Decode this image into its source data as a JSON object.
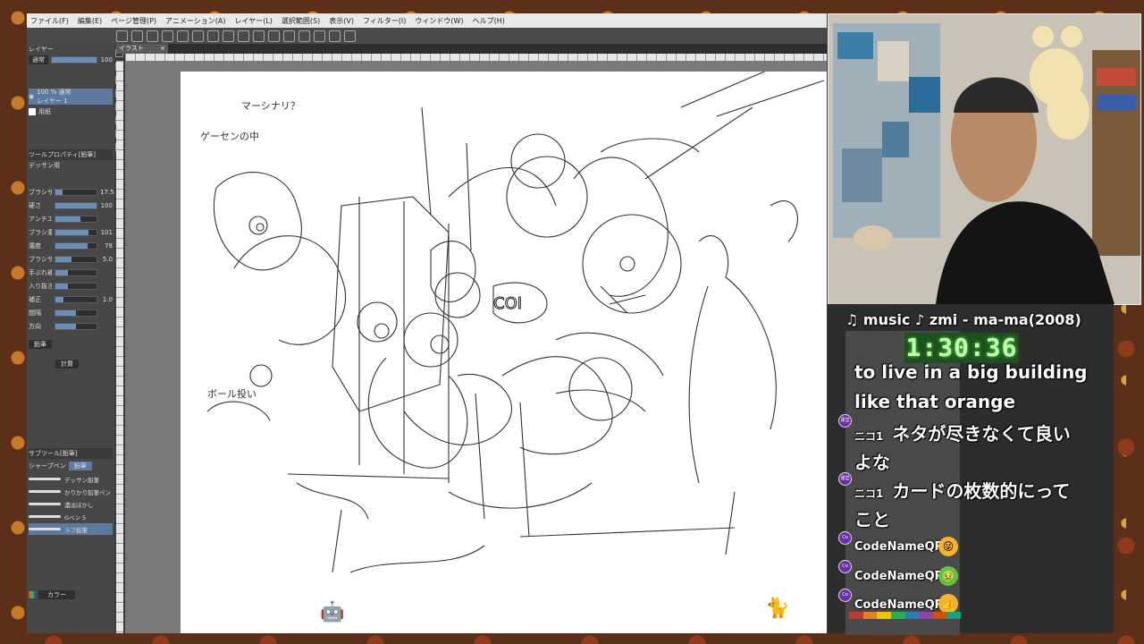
{
  "app": {
    "menu": [
      "ファイル(F)",
      "編集(E)",
      "ページ管理(P)",
      "アニメーション(A)",
      "レイヤー(L)",
      "選択範囲(S)",
      "表示(V)",
      "フィルター(I)",
      "ウィンドウ(W)",
      "ヘルプ(H)"
    ],
    "tab_label": "イラスト",
    "tab_close": "×"
  },
  "layer_panel": {
    "header": "レイヤー",
    "blend_mode": "通常",
    "opacity": "100",
    "layer1_name": "100 % 通常",
    "layer1_sub": "レイヤー 1",
    "paper_name": "用紙"
  },
  "tool_property": {
    "header": "ツールプロパティ[鉛筆]",
    "brush_name": "デッサン用",
    "rows": [
      {
        "label": "ブラシサイズ",
        "value": "17.5",
        "level": 0.18
      },
      {
        "label": "硬さ",
        "value": "100",
        "level": 1.0
      },
      {
        "label": "アンチエイリアス",
        "value": "",
        "level": 0.6
      },
      {
        "label": "ブラシ濃度",
        "value": "101",
        "level": 0.8
      },
      {
        "label": "濃度",
        "value": "78",
        "level": 0.78
      },
      {
        "label": "ブラシサイズ",
        "value": "5.0",
        "level": 0.4
      },
      {
        "label": "手ぶれ補正",
        "value": "",
        "level": 0.3
      },
      {
        "label": "入り抜き",
        "value": "",
        "level": 0.3
      },
      {
        "label": "補正",
        "value": "1.0",
        "level": 0.2
      },
      {
        "label": "間隔",
        "value": "",
        "level": 0.5
      },
      {
        "label": "方向",
        "value": "",
        "level": 0.5
      }
    ],
    "stabilizer_label": "鉛筆",
    "stroke_label": "計算"
  },
  "sub_tool": {
    "header": "サブツール[鉛筆]",
    "tab_active": "鉛筆",
    "tab_other": "シャープペン",
    "brushes": [
      "デッサン鉛筆",
      "かりかり鉛筆ペン",
      "濃淡ぼかし",
      "Gペン 5",
      "ラフ鉛筆"
    ]
  },
  "color_panel": {
    "label": "カラー"
  },
  "paper_notes": {
    "note1": "マーシナリ？",
    "note2": "ゲーセンの中",
    "note3": "ボール投い"
  },
  "stream": {
    "music": "♫ music ♪ zmi - ma-ma(2008)",
    "timer": "1:30:36",
    "lines": [
      {
        "prefix": "",
        "text": "to live in a big building"
      },
      {
        "prefix": "",
        "text": "like that orange"
      },
      {
        "prefix": "ニコ1",
        "text": "ネタが尽きなくて良い"
      },
      {
        "prefix": "",
        "text": "よな"
      },
      {
        "prefix": "ニコ1",
        "text": "カードの枚数的にって"
      },
      {
        "prefix": "",
        "text": "こと"
      }
    ],
    "nico_badge": "運営",
    "co_badge": "Co",
    "users": [
      {
        "name": "CodeNameQR",
        "emoji": "😜",
        "color": "#f5b42a"
      },
      {
        "name": "CodeNameQR",
        "emoji": "🤢",
        "color": "#5fc43b"
      },
      {
        "name": "CodeNameQR",
        "emoji": "👍",
        "color": "#f5b42a"
      }
    ]
  },
  "colors": {
    "accent_blue": "#5d79a0",
    "timer_green": "#c8ffb0",
    "badge_purple": "#6b2fa8"
  }
}
